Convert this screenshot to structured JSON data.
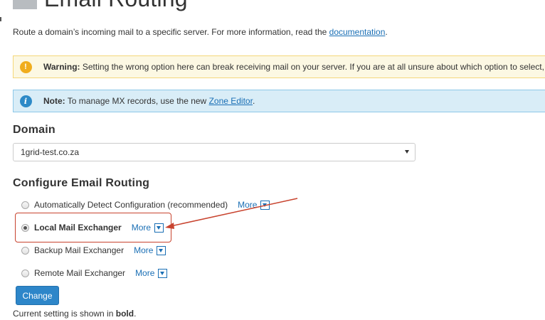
{
  "header": {
    "title": "Email Routing"
  },
  "description": {
    "text": "Route a domain’s incoming mail to a specific server. For more information, read the ",
    "link_label": "documentation",
    "suffix": "."
  },
  "alerts": {
    "warning": {
      "label": "Warning:",
      "text": " Setting the wrong option here can break receiving mail on your server. If you are at all unsure about which option to select,"
    },
    "note": {
      "label": "Note:",
      "text": " To manage MX records, use the new ",
      "link_label": "Zone Editor",
      "suffix": "."
    }
  },
  "domain_section": {
    "heading": "Domain",
    "selected_value": "1grid-test.co.za"
  },
  "routing_section": {
    "heading": "Configure Email Routing",
    "options": [
      {
        "label": "Automatically Detect Configuration (recommended)",
        "more_label": "More",
        "checked": false,
        "bold": false
      },
      {
        "label": "Local Mail Exchanger",
        "more_label": "More",
        "checked": true,
        "bold": true
      },
      {
        "label": "Backup Mail Exchanger",
        "more_label": "More",
        "checked": false,
        "bold": false
      },
      {
        "label": "Remote Mail Exchanger",
        "more_label": "More",
        "checked": false,
        "bold": false
      }
    ]
  },
  "actions": {
    "change_label": "Change"
  },
  "footnote": {
    "prefix": "Current setting is shown in ",
    "bold_word": "bold",
    "suffix": "."
  },
  "colors": {
    "link": "#1a6fb5",
    "button": "#2d86c9",
    "warning_bg": "#fcf8e3",
    "info_bg": "#d9edf7",
    "annotation": "#c8432e"
  },
  "icons": {
    "header": "envelope-icon",
    "warning": "exclamation-icon",
    "info": "info-icon",
    "more": "chevron-down-icon"
  }
}
